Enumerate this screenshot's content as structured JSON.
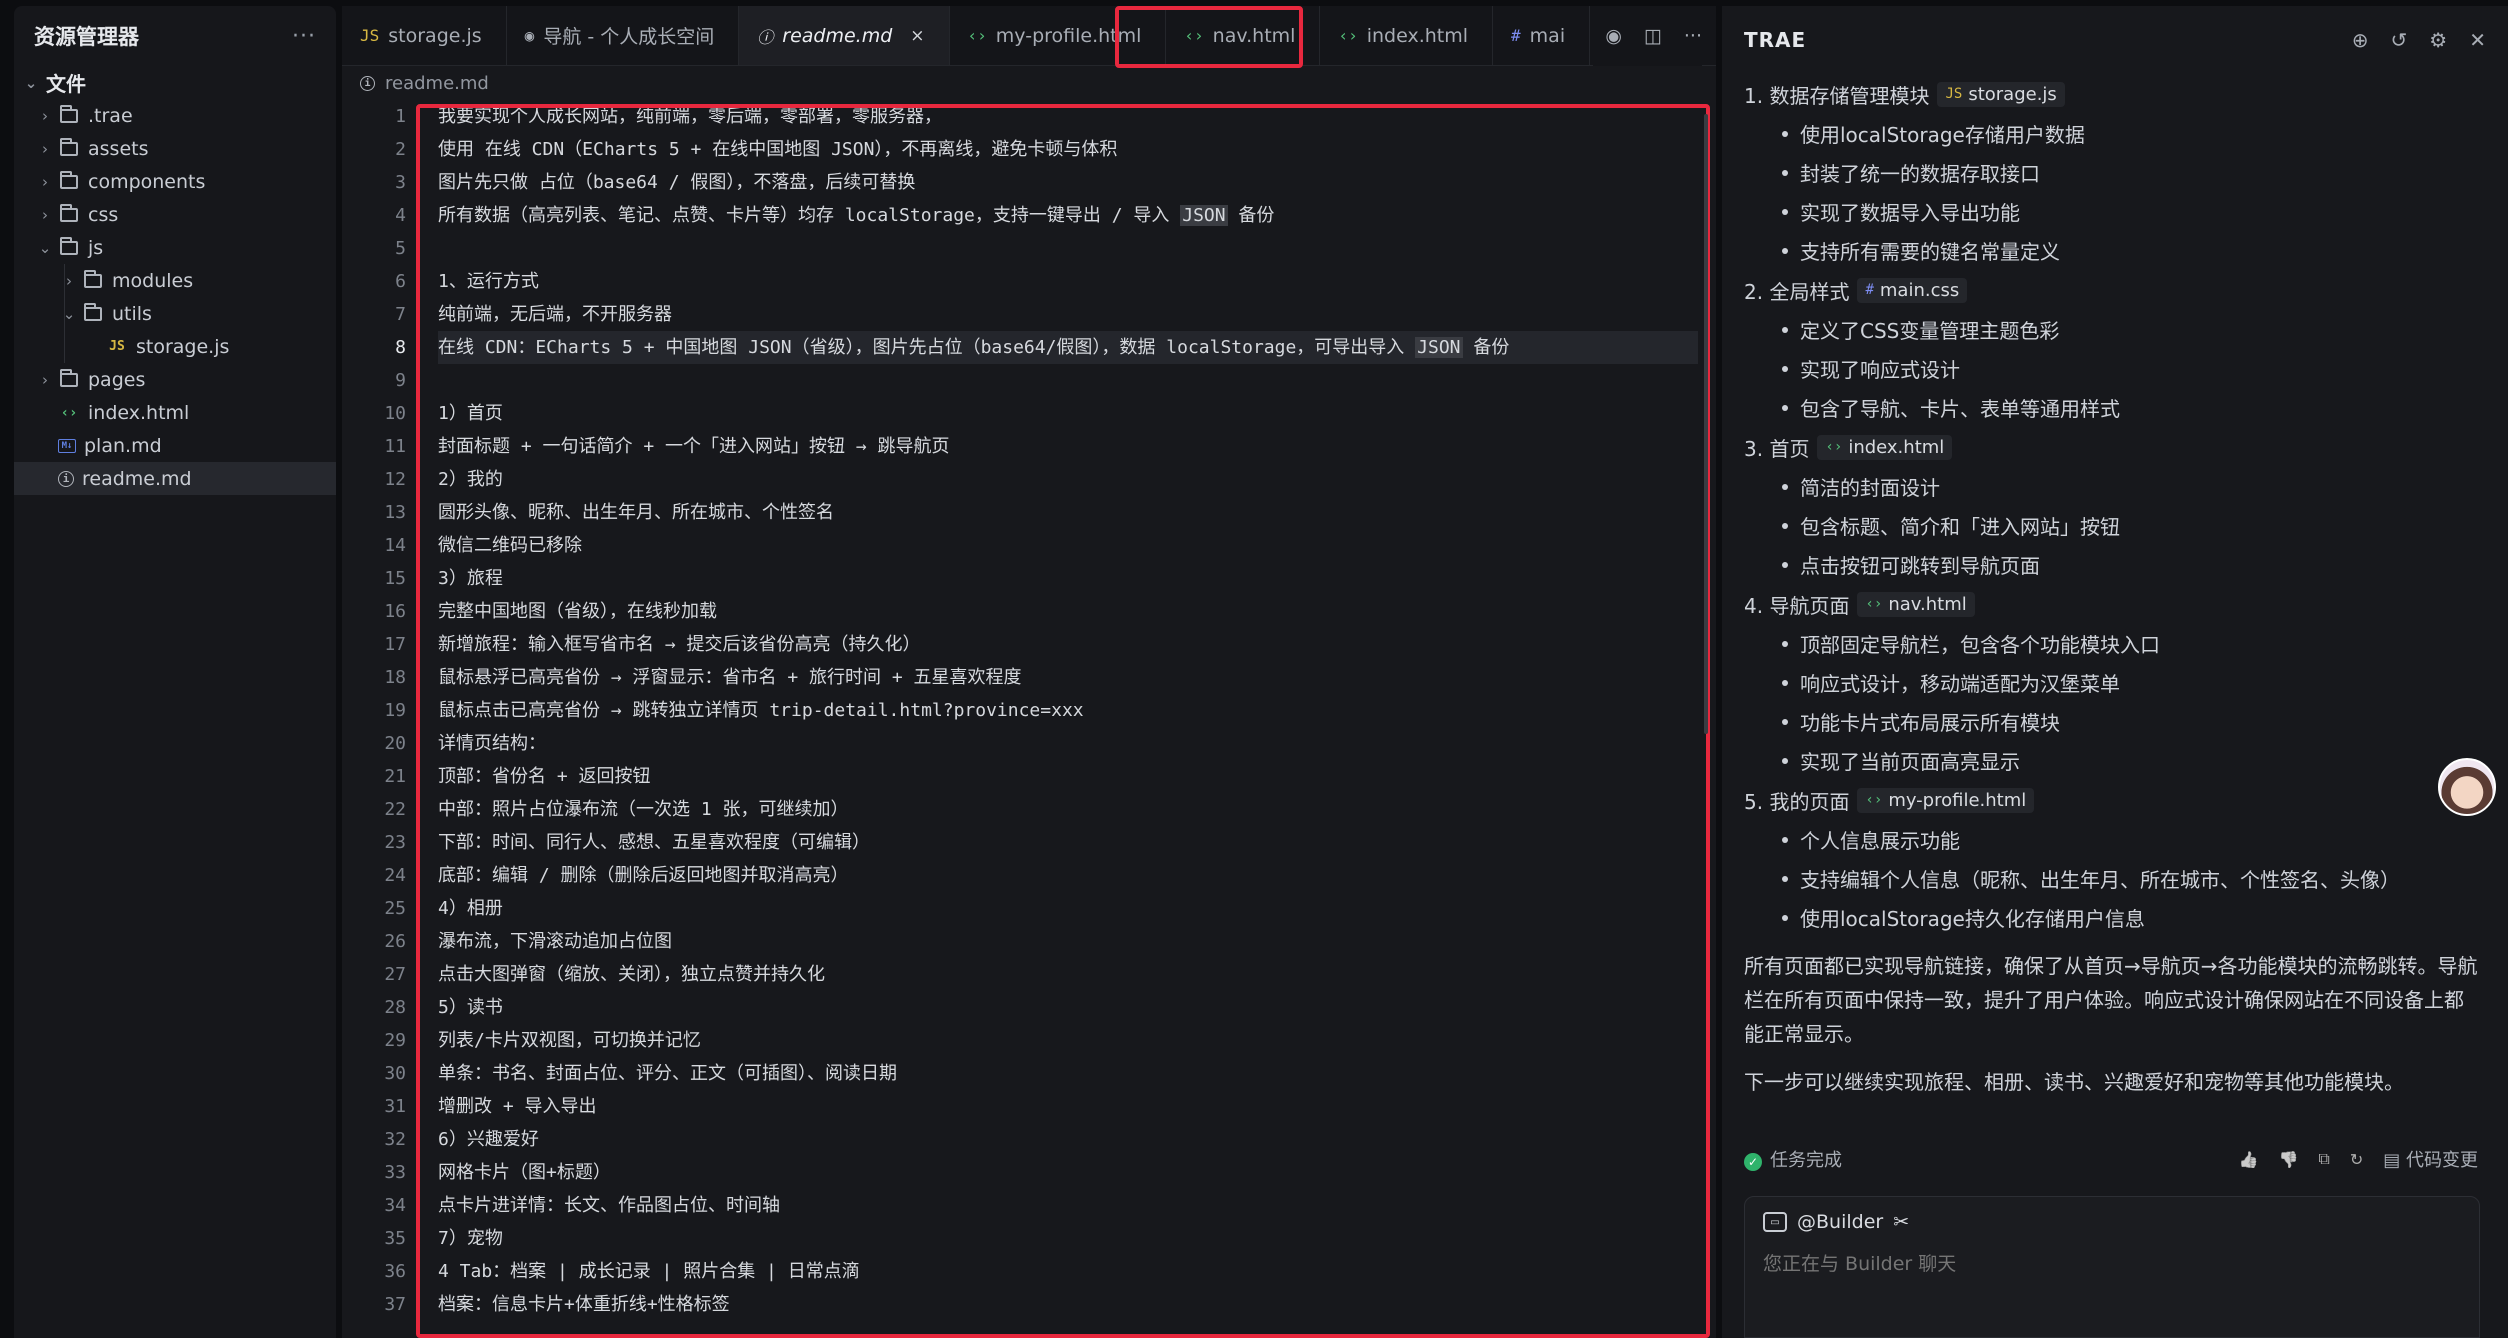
{
  "explorer": {
    "title": "资源管理器",
    "more": "···",
    "root": "文件",
    "items": [
      {
        "label": ".trae",
        "type": "folder",
        "depth": 1,
        "expanded": false
      },
      {
        "label": "assets",
        "type": "folder",
        "depth": 1,
        "expanded": false
      },
      {
        "label": "components",
        "type": "folder",
        "depth": 1,
        "expanded": false
      },
      {
        "label": "css",
        "type": "folder",
        "depth": 1,
        "expanded": false
      },
      {
        "label": "js",
        "type": "folder",
        "depth": 1,
        "expanded": true
      },
      {
        "label": "modules",
        "type": "folder",
        "depth": 2,
        "expanded": false
      },
      {
        "label": "utils",
        "type": "folder",
        "depth": 2,
        "expanded": true
      },
      {
        "label": "storage.js",
        "type": "js",
        "depth": 3
      },
      {
        "label": "pages",
        "type": "folder",
        "depth": 1,
        "expanded": false
      },
      {
        "label": "index.html",
        "type": "html",
        "depth": 1
      },
      {
        "label": "plan.md",
        "type": "md",
        "depth": 1
      },
      {
        "label": "readme.md",
        "type": "info",
        "depth": 1,
        "selected": true
      }
    ]
  },
  "tabs": [
    {
      "label": "storage.js",
      "icon": "JS",
      "type": "js"
    },
    {
      "label": "导航 - 个人成长空间",
      "icon": "◉",
      "type": "preview"
    },
    {
      "label": "readme.md",
      "icon": "ⓘ",
      "type": "info",
      "active": true,
      "close": "×"
    },
    {
      "label": "my-profile.html",
      "icon": "‹›",
      "type": "html"
    },
    {
      "label": "nav.html",
      "icon": "‹›",
      "type": "html"
    },
    {
      "label": "index.html",
      "icon": "‹›",
      "type": "html"
    },
    {
      "label": "mai",
      "icon": "#",
      "type": "css"
    }
  ],
  "breadcrumb": "readme.md",
  "editor": {
    "current_line": 8,
    "lines": [
      "我要实现个人成长网站，纯前端，零后端，零部署，零服务器，",
      "使用 在线 CDN（ECharts 5 + 在线中国地图 JSON），不再离线，避免卡顿与体积",
      "图片先只做 占位（base64 / 假图），不落盘，后续可替换",
      "所有数据（高亮列表、笔记、点赞、卡片等）均存 localStorage，支持一键导出 / 导入 JSON 备份",
      "",
      "1、运行方式",
      "纯前端，无后端，不开服务器",
      "在线 CDN：ECharts 5 + 中国地图 JSON（省级），图片先占位（base64/假图），数据 localStorage，可导出导入 JSON 备份",
      "",
      "1）首页",
      "封面标题 + 一句话简介 + 一个「进入网站」按钮 → 跳导航页",
      "2）我的",
      "圆形头像、昵称、出生年月、所在城市、个性签名",
      "微信二维码已移除",
      "3）旅程",
      "完整中国地图（省级），在线秒加载",
      "新增旅程：输入框写省市名 → 提交后该省份高亮（持久化）",
      "鼠标悬浮已高亮省份 → 浮窗显示：省市名 + 旅行时间 + 五星喜欢程度",
      "鼠标点击已高亮省份 → 跳转独立详情页 trip-detail.html?province=xxx",
      "详情页结构：",
      "顶部：省份名 + 返回按钮",
      "中部：照片占位瀑布流（一次选 1 张，可继续加）",
      "下部：时间、同行人、感想、五星喜欢程度（可编辑）",
      "底部：编辑 / 删除（删除后返回地图并取消高亮）",
      "4）相册",
      "瀑布流，下滑滚动追加占位图",
      "点击大图弹窗（缩放、关闭），独立点赞并持久化",
      "5）读书",
      "列表/卡片双视图，可切换并记忆",
      "单条：书名、封面占位、评分、正文（可插图）、阅读日期",
      "增删改 + 导入导出",
      "6）兴趣爱好",
      "网格卡片（图+标题）",
      "点卡片进详情：长文、作品图占位、时间轴",
      "7）宠物",
      "4 Tab：档案 | 成长记录 | 照片合集 | 日常点滴",
      "档案：信息卡片+体重折线+性格标签"
    ]
  },
  "trae": {
    "title": "TRAE",
    "sections": [
      {
        "title": "1. 数据存储管理模块",
        "chip_icon": "JS",
        "chip": "storage.js",
        "bullets": [
          "使用localStorage存储用户数据",
          "封装了统一的数据存取接口",
          "实现了数据导入导出功能",
          "支持所有需要的键名常量定义"
        ]
      },
      {
        "title": "2. 全局样式",
        "chip_icon": "#",
        "chip": "main.css",
        "bullets": [
          "定义了CSS变量管理主题色彩",
          "实现了响应式设计",
          "包含了导航、卡片、表单等通用样式"
        ]
      },
      {
        "title": "3. 首页",
        "chip_icon": "‹›",
        "chip": "index.html",
        "bullets": [
          "简洁的封面设计",
          "包含标题、简介和「进入网站」按钮",
          "点击按钮可跳转到导航页面"
        ]
      },
      {
        "title": "4. 导航页面",
        "chip_icon": "‹›",
        "chip": "nav.html",
        "bullets": [
          "顶部固定导航栏，包含各个功能模块入口",
          "响应式设计，移动端适配为汉堡菜单",
          "功能卡片式布局展示所有模块",
          "实现了当前页面高亮显示"
        ]
      },
      {
        "title": "5. 我的页面",
        "chip_icon": "‹›",
        "chip": "my-profile.html",
        "bullets": [
          "个人信息展示功能",
          "支持编辑个人信息（昵称、出生年月、所在城市、个性签名、头像）",
          "使用localStorage持久化存储用户信息"
        ]
      }
    ],
    "summary": "所有页面都已实现导航链接，确保了从首页→导航页→各功能模块的流畅跳转。导航栏在所有页面中保持一致，提升了用户体验。响应式设计确保网站在不同设备上都能正常显示。",
    "next": "下一步可以继续实现旅程、相册、读书、兴趣爱好和宠物等其他功能模块。",
    "status": "任务完成",
    "code_changes": "代码变更",
    "builder": "@Builder",
    "chat_placeholder": "您正在与 Builder 聊天"
  },
  "colors": {
    "highlight_border": "#e8283e",
    "success": "#2fb36b",
    "js": "#d7b843",
    "html": "#54c07a"
  }
}
